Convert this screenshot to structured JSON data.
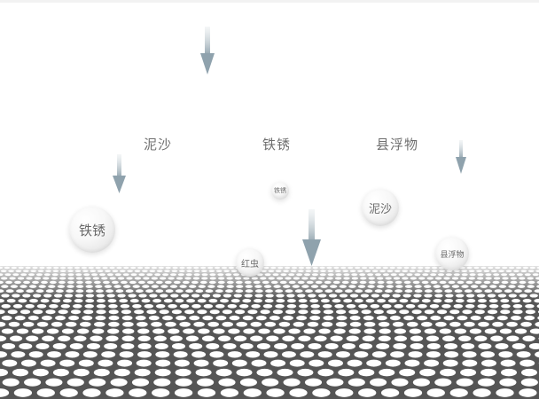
{
  "labels": {
    "silt": "泥沙",
    "rust": "铁锈",
    "suspended": "县浮物"
  },
  "bubbles": {
    "rust_large": "铁锈",
    "rust_small": "铁锈",
    "silt": "泥沙",
    "red_worm": "红虫",
    "suspended": "县浮物"
  },
  "colors": {
    "background": "#ffffff",
    "mesh_dark": "#555555",
    "mesh_hole": "#ffffff",
    "arrow": "#8fa2ad",
    "text": "#6f6f6f"
  },
  "icons": [
    "down-arrow-icon"
  ]
}
